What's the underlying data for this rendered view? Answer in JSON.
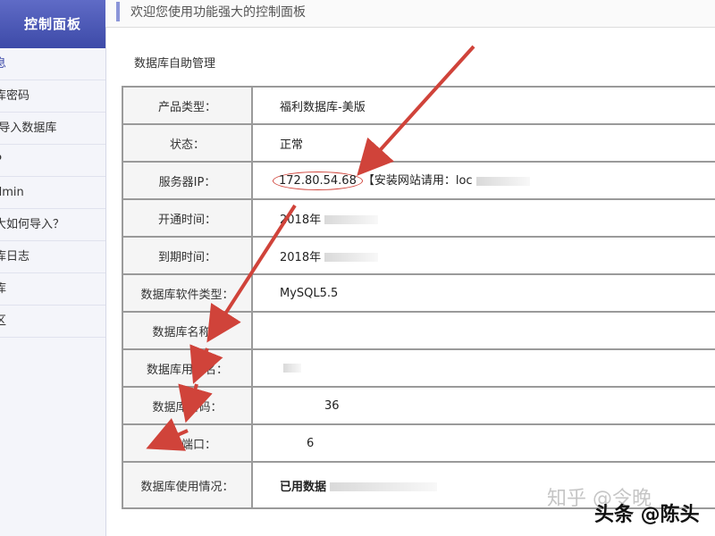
{
  "sidebar": {
    "title": "控制面板",
    "items": [
      {
        "label": "息"
      },
      {
        "label": "库密码"
      },
      {
        "label": "/导入数据库"
      },
      {
        "label": "P"
      },
      {
        "label": "dmin"
      },
      {
        "label": "大如何导入？"
      },
      {
        "label": "库日志"
      },
      {
        "label": "库"
      },
      {
        "label": "区"
      }
    ]
  },
  "header": {
    "welcome": "欢迎您使用功能强大的控制面板"
  },
  "main": {
    "section_title": "数据库自助管理",
    "rows": [
      {
        "label": "产品类型：",
        "value": "福利数据库-美版"
      },
      {
        "label": "状态：",
        "value": "正常"
      },
      {
        "label": "服务器IP：",
        "ip": "172.80.54.68",
        "note": "【安装网站请用：loc"
      },
      {
        "label": "开通时间：",
        "value": "2018年"
      },
      {
        "label": "到期时间：",
        "value": "2018年"
      },
      {
        "label": "数据库软件类型：",
        "value": "MySQL5.5"
      },
      {
        "label": "数据库名称：",
        "value": ""
      },
      {
        "label": "数据库用户名：",
        "value": ""
      },
      {
        "label": "数据库密码：",
        "value": "36"
      },
      {
        "label": "连接端口：",
        "value": "6"
      },
      {
        "label": "数据库使用情况：",
        "value": "已用数据"
      }
    ]
  },
  "watermark": {
    "zhihu": "知乎 @令晚",
    "toutiao": "头条 @陈头"
  },
  "colors": {
    "sidebar_header": "#4553b0",
    "annotation_red": "#d0433a"
  }
}
